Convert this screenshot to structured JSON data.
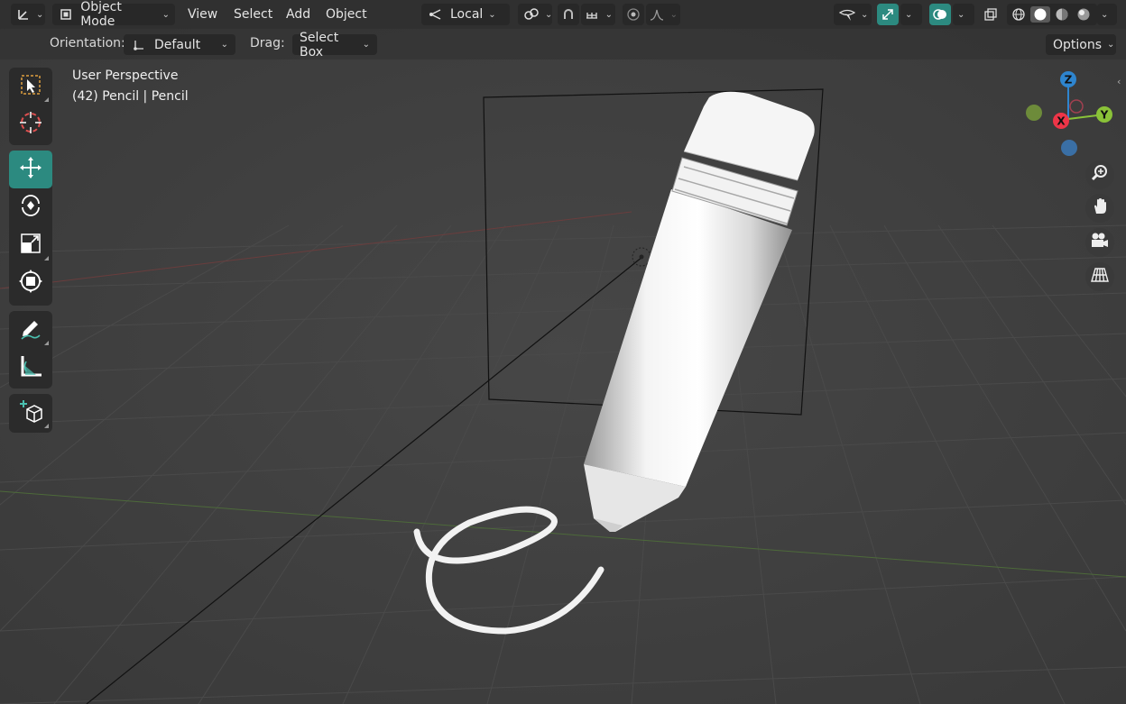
{
  "header": {
    "editor_type_icon": "axis-gizmo-icon",
    "mode_label": "Object Mode",
    "menus": [
      "View",
      "Select",
      "Add",
      "Object"
    ],
    "transform_orientation": "Local",
    "pivot_icon": "pivot-icon",
    "snap_icon": "magnet-icon",
    "snap_target_icon": "snap-increment-icon",
    "proportional_icon": "proportional-edit-icon",
    "falloff_icon": "falloff-curve-icon",
    "visibility_icon": "selectability-icon",
    "gizmo_icon": "gizmo-icon",
    "overlay_icon": "overlay-icon",
    "xray_icon": "xray-icon",
    "shading_modes": [
      "wireframe",
      "solid",
      "material-preview",
      "rendered"
    ]
  },
  "tool_settings": {
    "orientation_label": "Orientation:",
    "orientation_value": "Default",
    "drag_label": "Drag:",
    "drag_value": "Select Box",
    "options_label": "Options"
  },
  "viewport": {
    "view_name": "User Perspective",
    "object_info": "(42) Pencil | Pencil"
  },
  "toolbar": {
    "tools": [
      "select-box",
      "cursor",
      "move",
      "rotate",
      "scale",
      "transform",
      "annotate",
      "measure",
      "add-cube"
    ],
    "active_tool": "move"
  },
  "gizmo": {
    "axes": [
      "Z",
      "X",
      "Y"
    ],
    "colors": {
      "x": "#ee3548",
      "y": "#8ac238",
      "z": "#2e85cf"
    }
  },
  "navigation": [
    "zoom-icon",
    "hand-pan-icon",
    "camera-icon",
    "grid-perspective-icon"
  ],
  "colors": {
    "accent": "#2c8a80",
    "header_bg": "#303030",
    "viewport_bg": "#3d3d3d"
  }
}
